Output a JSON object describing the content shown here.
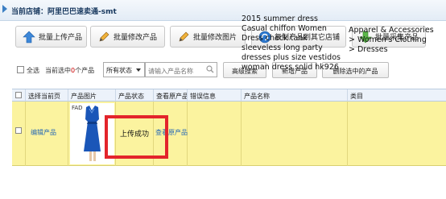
{
  "header": {
    "title": "当前店铺：阿里巴巴速卖通-smt"
  },
  "toolbar": {
    "batch_upload": "批量上传产品",
    "batch_edit": "批量修改产品",
    "batch_edit_images": "批量修改图片",
    "copy_to_store": "复制产品到其它店铺",
    "batch_collect": "批量采集产品"
  },
  "filter": {
    "select_all": "全选",
    "selected_count_prefix": "当前选中",
    "selected_count": "0",
    "selected_count_suffix": "个产品",
    "status_value": "所有状态",
    "search_placeholder": "请输入产品名称",
    "advanced_search": "高级搜索",
    "add_product": "新增产品",
    "delete_selected": "删除选中的产品"
  },
  "table": {
    "columns": [
      "选择当前页",
      "产品图片",
      "产品状态",
      "查看原产品",
      "错误信息",
      "产品名称",
      "类目"
    ],
    "rows": [
      {
        "action": "编辑产品",
        "image_brand": "FAD",
        "status": "上传成功",
        "view_original": "查看原产品",
        "error": "",
        "name": "2015 summer dress Casual chiffon Women Dress check tank sleeveless long party dresses plus size vestidos woman dress solid hk926",
        "category": "Apparel & Accessories > Women's Clothing > Dresses"
      }
    ]
  },
  "colors": {
    "highlight": "#e3242b",
    "row_bg": "#fbf39f",
    "link": "#2a6bb5",
    "header_text": "#1a3a60"
  }
}
